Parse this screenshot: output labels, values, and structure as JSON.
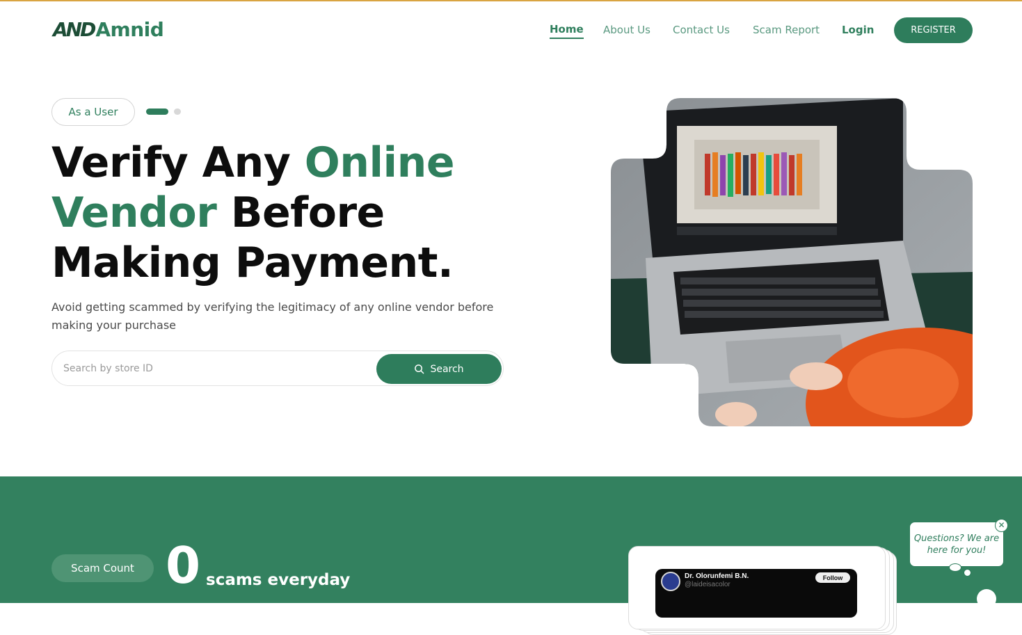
{
  "brand": {
    "logo_mark": "AND",
    "logo_text": "Amnid"
  },
  "nav": {
    "home": "Home",
    "about": "About Us",
    "contact": "Contact Us",
    "scam_report": "Scam Report",
    "login": "Login",
    "register": "REGISTER"
  },
  "hero": {
    "user_pill": "As a User",
    "slide_indicator": {
      "total": 2,
      "active": 1
    },
    "headline_part1": "Verify Any ",
    "headline_green1": "Online",
    "headline_green2": "Vendor",
    "headline_part2": " Before Making Payment.",
    "subtext": "Avoid getting scammed by verifying the legitimacy of any online vendor before making your purchase",
    "search_placeholder": "Search by store ID",
    "search_button": "Search"
  },
  "stats": {
    "label": "Scam Count",
    "count": "0",
    "suffix": "scams everyday"
  },
  "testimonial": {
    "name": "Dr. Olorunfemi B.N.",
    "handle": "@laideisacolor",
    "follow": "Follow"
  },
  "chat": {
    "message": "Questions? We are here for you!",
    "close": "✕"
  },
  "colors": {
    "brand_green": "#2e7d5c",
    "dark_green": "#1d4d36",
    "section_green": "#33815f",
    "top_accent": "#d9a441"
  }
}
